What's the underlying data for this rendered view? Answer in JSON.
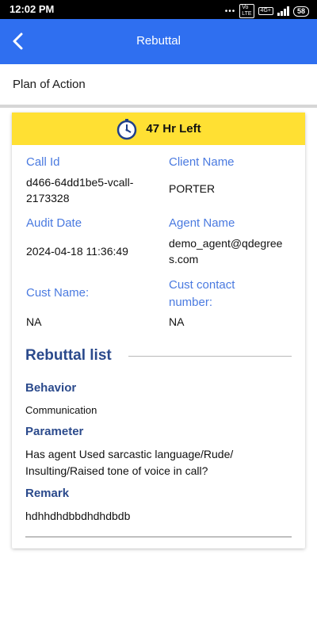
{
  "status_bar": {
    "time": "12:02 PM",
    "battery": "58",
    "network": "4G+"
  },
  "app_bar": {
    "title": "Rebuttal"
  },
  "page": {
    "section_title": "Plan of Action"
  },
  "timer": {
    "text": "47 Hr Left"
  },
  "fields": {
    "call_id": {
      "label": "Call Id",
      "value": "d466-64dd1be5-vcall-2173328"
    },
    "client_name": {
      "label": "Client Name",
      "value": "PORTER"
    },
    "audit_date": {
      "label": "Audit Date",
      "value": "2024-04-18 11:36:49"
    },
    "agent_name": {
      "label": "Agent Name",
      "value": "demo_agent@qdegrees.com"
    },
    "cust_name": {
      "label": "Cust Name:",
      "value": "NA"
    },
    "cust_contact": {
      "label": "Cust contact number:",
      "value": "NA"
    }
  },
  "rebuttal": {
    "header": "Rebuttal list",
    "behavior_label": "Behavior",
    "behavior_value": "Communication",
    "parameter_label": "Parameter",
    "parameter_value": "Has agent Used sarcastic language/Rude/ Insulting/Raised tone of voice in call?",
    "remark_label": "Remark",
    "remark_value": "hdhhdhdbbdhdhdbdb"
  },
  "colors": {
    "app_bar": "#2f6ff0",
    "timer_bg": "#ffe033",
    "label_blue": "#4a7ae0",
    "heading_navy": "#2b4a8c"
  }
}
